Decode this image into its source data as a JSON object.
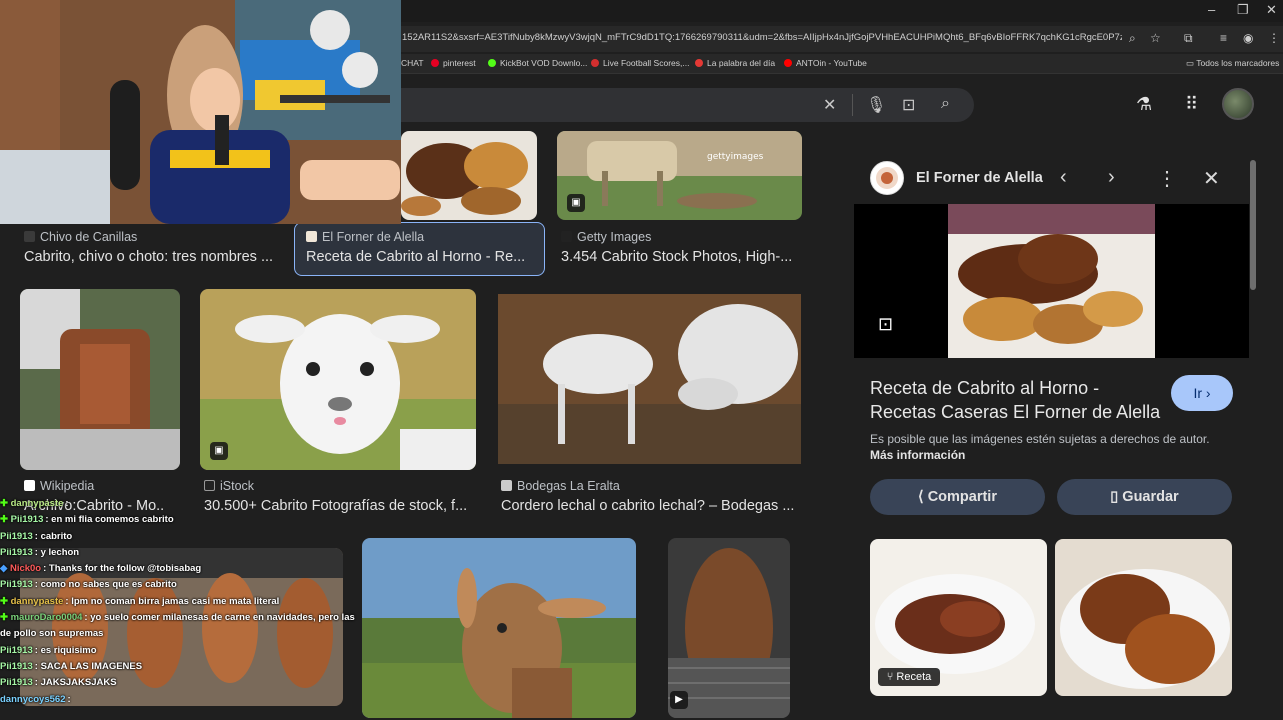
{
  "browser": {
    "url": "152AR11S2&sxsrf=AE3TifNuby8kMzwyV3wjqN_mFTrC9dD1TQ:1766269790311&udm=2&fbs=AIIjpHx4nJjfGojPVHhEACUHPiMQht6_BFq6vBIoFFRK7qchKG1cRgcE0P7z3SNiz...",
    "bookmarks": [
      "CHAT",
      "pinterest",
      "KickBot VOD Downlo...",
      "Live Football Scores,...",
      "La palabra del día",
      "ANTOin - YouTube"
    ],
    "bookmarks_folder": "Todos los marcadores"
  },
  "results": [
    {
      "source": "Chivo de Canillas",
      "title": "Cabrito, chivo o choto: tres nombres ..."
    },
    {
      "source": "El Forner de Alella",
      "title": "Receta de Cabrito al Horno - Re..."
    },
    {
      "source": "Getty Images",
      "title": "3.454 Cabrito Stock Photos, High-..."
    },
    {
      "source": "Wikipedia",
      "title": "Archivo:Cabrito - Mo..."
    },
    {
      "source": "iStock",
      "title": "30.500+ Cabrito Fotografías de stock, f..."
    },
    {
      "source": "Bodegas La Eralta",
      "title": "Cordero lechal o cabrito lechal? – Bodegas ..."
    }
  ],
  "watermark": "gettyimages",
  "panel": {
    "site": "El Forner de Alella",
    "title": "Receta de Cabrito al Horno - Recetas Caseras El Forner de Alella",
    "go_button": "Ir",
    "note_prefix": "Es posible que las imágenes estén sujetas a derechos de autor.",
    "note_link": "Más información",
    "share": "Compartir",
    "save": "Guardar",
    "recipe_badge": "Receta"
  },
  "chat": [
    {
      "user": "dannypaste",
      "text": "",
      "color": "#b8e986",
      "badge": "green"
    },
    {
      "user": "Pii1913",
      "text": "en mi flia comemos cabrito",
      "color": "#a6f7a6",
      "badge": "green"
    },
    {
      "user": "Pii1913",
      "text": "cabrito",
      "color": "#a6f7a6",
      "badge": ""
    },
    {
      "user": "Pii1913",
      "text": "y lechon",
      "color": "#a6f7a6",
      "badge": ""
    },
    {
      "user": "Nick0o",
      "text": "Thanks for the follow @tobisabag",
      "color": "#ff5a5a",
      "badge": "blue"
    },
    {
      "user": "Pii1913",
      "text": "como no sabes que es cabrito",
      "color": "#a6f7a6",
      "badge": ""
    },
    {
      "user": "dannypaste",
      "text": "lpm no coman birra jamas casi me mata literal",
      "color": "#e6c14a",
      "badge": "green"
    },
    {
      "user": "mauroDaro0004",
      "text": "yo suelo comer milanesas de carne en navidades, pero las de pollo son supremas",
      "color": "#7ad17a",
      "badge": "green"
    },
    {
      "user": "Pii1913",
      "text": "es riquisimo",
      "color": "#a6f7a6",
      "badge": ""
    },
    {
      "user": "Pii1913",
      "text": "SACA LAS IMAGENES",
      "color": "#a6f7a6",
      "badge": ""
    },
    {
      "user": "Pii1913",
      "text": "JAKSJAKSJAKS",
      "color": "#a6f7a6",
      "badge": ""
    },
    {
      "user": "dannycoys562",
      "text": "",
      "color": "#7ad1ff",
      "badge": ""
    }
  ]
}
